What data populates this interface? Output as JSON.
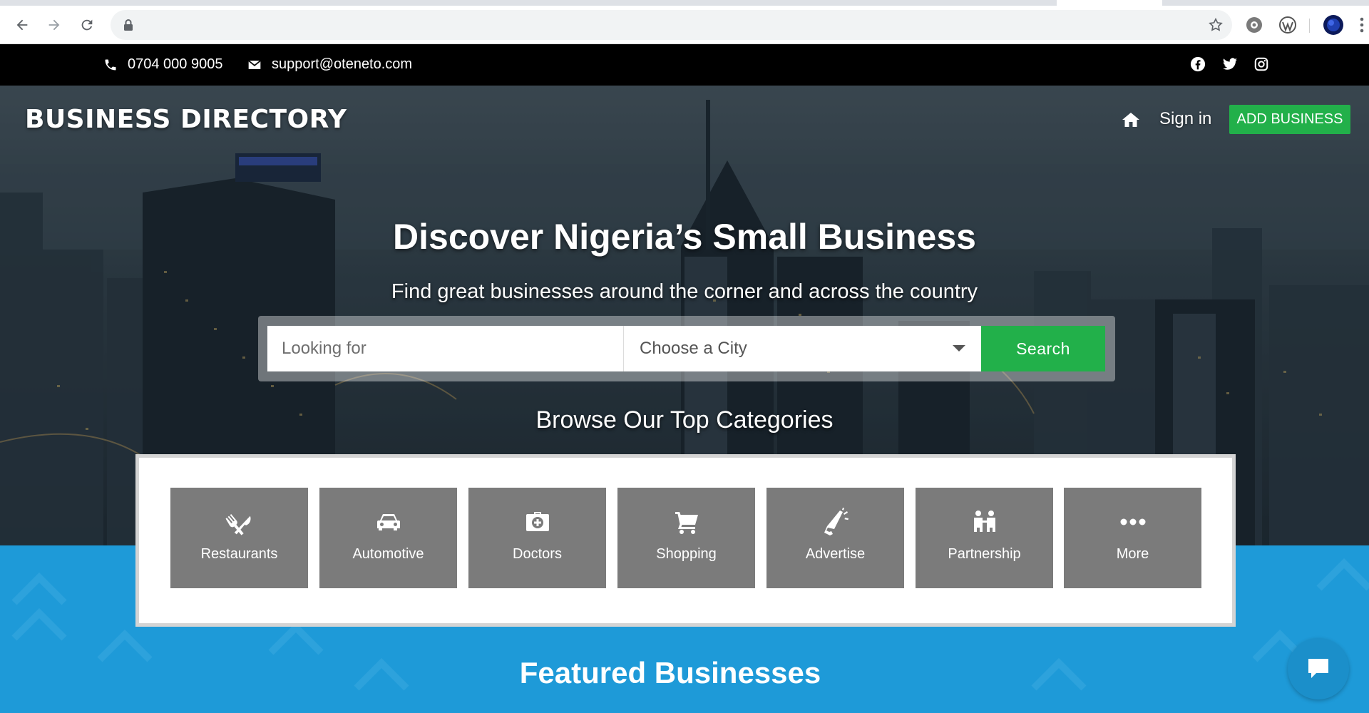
{
  "browser": {
    "icons": [
      "back-arrow-icon",
      "forward-arrow-icon",
      "reload-icon",
      "lock-icon",
      "bookmark-star-icon",
      "extension-settings-icon",
      "wordpress-icon",
      "profile-avatar-icon",
      "menu-dots-icon"
    ]
  },
  "contact": {
    "phone": "0704 000 9005",
    "email": "support@oteneto.com",
    "social": [
      "facebook-icon",
      "twitter-icon",
      "instagram-icon"
    ]
  },
  "nav": {
    "brand": "BUSINESS DIRECTORY",
    "signin": "Sign in",
    "add_business": "ADD BUSINESS"
  },
  "hero": {
    "title": "Discover Nigeria’s Small Business",
    "subtitle": "Find great businesses around the corner and across the country"
  },
  "search": {
    "placeholder": "Looking for",
    "city_selected": "Choose a City",
    "button": "Search"
  },
  "categories": {
    "title": "Browse Our Top Categories",
    "items": [
      {
        "label": "Restaurants",
        "icon": "utensils-icon"
      },
      {
        "label": "Automotive",
        "icon": "car-icon"
      },
      {
        "label": "Doctors",
        "icon": "medical-kit-icon"
      },
      {
        "label": "Shopping",
        "icon": "cart-icon"
      },
      {
        "label": "Advertise",
        "icon": "megaphone-icon"
      },
      {
        "label": "Partnership",
        "icon": "people-icon"
      },
      {
        "label": "More",
        "icon": "more-dots-icon"
      }
    ]
  },
  "featured": {
    "title": "Featured Businesses"
  },
  "colors": {
    "accent_green": "#22b04a",
    "band_blue": "#1e9ad8",
    "tile_gray": "#7b7b7b",
    "topbar_black": "#000000"
  }
}
